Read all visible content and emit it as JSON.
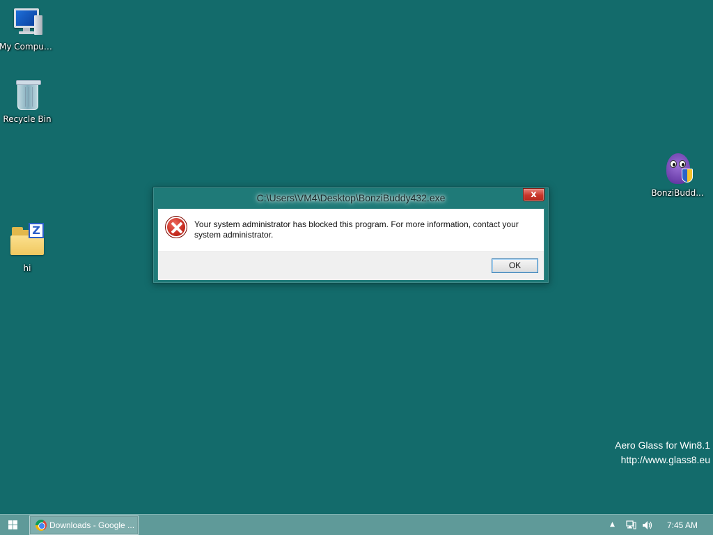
{
  "desktop": {
    "icons": [
      {
        "label": "My Computer",
        "icon": "computer-icon"
      },
      {
        "label": "Recycle Bin",
        "icon": "recycle-bin-icon"
      },
      {
        "label": "hi",
        "icon": "folder-icon"
      },
      {
        "label": "BonziBudd...",
        "icon": "bonzibuddy-icon"
      }
    ],
    "watermark": {
      "line1": "Aero Glass for Win8.1",
      "line2": "http://www.glass8.eu"
    },
    "background_color": "#136b6b"
  },
  "dialog": {
    "title": "C:\\Users\\VM4\\Desktop\\BonziBuddy432.exe",
    "close_label": "x",
    "message": "Your system administrator has blocked this program. For more information, contact your system administrator.",
    "ok_label": "OK",
    "icon": "error-icon"
  },
  "taskbar": {
    "task_label": "Downloads - Google ...",
    "clock": "7:45 AM",
    "tray_expand_label": "▲"
  }
}
